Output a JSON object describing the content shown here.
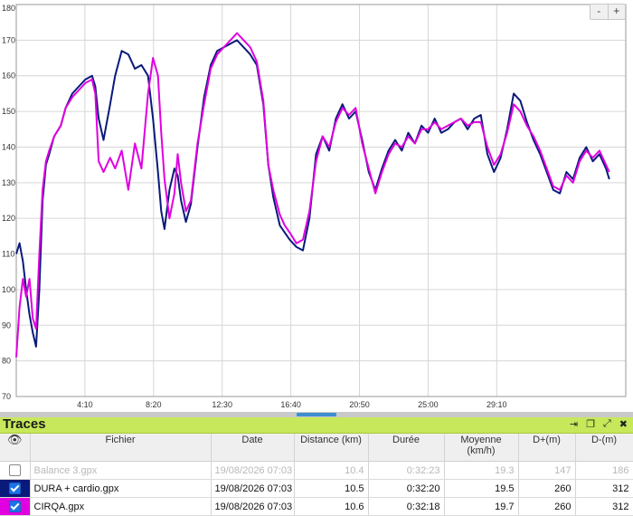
{
  "chart_data": {
    "type": "line",
    "title": "",
    "xlabel": "",
    "ylabel": "",
    "ylim": [
      70,
      180
    ],
    "yticks": [
      70,
      80,
      90,
      100,
      110,
      120,
      130,
      140,
      150,
      160,
      170,
      180
    ],
    "xlim_minutes": [
      0,
      37
    ],
    "xticks": [
      {
        "label": "4:10",
        "value": 4.167
      },
      {
        "label": "8:20",
        "value": 8.333
      },
      {
        "label": "12:30",
        "value": 12.5
      },
      {
        "label": "16:40",
        "value": 16.667
      },
      {
        "label": "20:50",
        "value": 20.833
      },
      {
        "label": "25:00",
        "value": 25.0
      },
      {
        "label": "29:10",
        "value": 29.167
      }
    ],
    "grid": true,
    "series": [
      {
        "name": "DURA + cardio.gpx",
        "color": "#0a1a7a",
        "x": [
          0,
          0.2,
          0.4,
          0.6,
          0.8,
          1.0,
          1.2,
          1.4,
          1.6,
          1.8,
          2.0,
          2.3,
          2.7,
          3.0,
          3.4,
          3.8,
          4.2,
          4.6,
          4.8,
          5.0,
          5.3,
          5.7,
          6.0,
          6.4,
          6.8,
          7.2,
          7.6,
          8.0,
          8.3,
          8.6,
          8.8,
          9.0,
          9.3,
          9.6,
          9.8,
          10.0,
          10.3,
          10.6,
          11.0,
          11.4,
          11.8,
          12.2,
          12.6,
          13.0,
          13.4,
          13.8,
          14.2,
          14.6,
          15.0,
          15.3,
          15.6,
          16.0,
          16.3,
          16.6,
          17.0,
          17.4,
          17.8,
          18.2,
          18.6,
          19.0,
          19.4,
          19.8,
          20.2,
          20.6,
          21.0,
          21.4,
          21.8,
          22.2,
          22.6,
          23.0,
          23.4,
          23.8,
          24.2,
          24.6,
          25.0,
          25.4,
          25.8,
          26.2,
          26.6,
          27.0,
          27.4,
          27.8,
          28.2,
          28.6,
          29.0,
          29.4,
          29.8,
          30.2,
          30.6,
          31.0,
          31.4,
          31.8,
          32.2,
          32.6,
          33.0,
          33.4,
          33.8,
          34.2,
          34.6,
          35.0,
          35.4,
          35.8,
          36.0
        ],
        "values": [
          110,
          113,
          108,
          100,
          93,
          88,
          84,
          100,
          125,
          135,
          138,
          143,
          146,
          151,
          155,
          157,
          159,
          160,
          157,
          148,
          142,
          152,
          160,
          167,
          166,
          162,
          163,
          160,
          148,
          133,
          122,
          117,
          128,
          134,
          132,
          125,
          119,
          124,
          140,
          154,
          163,
          167,
          168,
          169,
          170,
          168,
          166,
          163,
          152,
          135,
          126,
          118,
          116,
          114,
          112,
          111,
          120,
          138,
          143,
          139,
          148,
          152,
          148,
          150,
          142,
          133,
          128,
          134,
          139,
          142,
          139,
          144,
          141,
          146,
          144,
          148,
          144,
          145,
          147,
          148,
          145,
          148,
          149,
          138,
          133,
          137,
          145,
          155,
          153,
          147,
          142,
          138,
          133,
          128,
          127,
          133,
          131,
          137,
          140,
          136,
          138,
          134,
          131
        ]
      },
      {
        "name": "CIRQA.gpx",
        "color": "#e000e0",
        "x": [
          0,
          0.2,
          0.4,
          0.6,
          0.8,
          1.0,
          1.2,
          1.4,
          1.6,
          1.8,
          2.0,
          2.3,
          2.7,
          3.0,
          3.4,
          3.8,
          4.2,
          4.6,
          4.8,
          5.0,
          5.3,
          5.7,
          6.0,
          6.4,
          6.8,
          7.2,
          7.6,
          8.0,
          8.3,
          8.6,
          8.8,
          9.0,
          9.3,
          9.6,
          9.8,
          10.0,
          10.3,
          10.6,
          11.0,
          11.4,
          11.8,
          12.2,
          12.6,
          13.0,
          13.4,
          13.8,
          14.2,
          14.6,
          15.0,
          15.3,
          15.6,
          16.0,
          16.3,
          16.6,
          17.0,
          17.4,
          17.8,
          18.2,
          18.6,
          19.0,
          19.4,
          19.8,
          20.2,
          20.6,
          21.0,
          21.4,
          21.8,
          22.2,
          22.6,
          23.0,
          23.4,
          23.8,
          24.2,
          24.6,
          25.0,
          25.4,
          25.8,
          26.2,
          26.6,
          27.0,
          27.4,
          27.8,
          28.2,
          28.6,
          29.0,
          29.4,
          29.8,
          30.2,
          30.6,
          31.0,
          31.4,
          31.8,
          32.2,
          32.6,
          33.0,
          33.4,
          33.8,
          34.2,
          34.6,
          35.0,
          35.4,
          35.8,
          36.0
        ],
        "values": [
          81,
          95,
          103,
          98,
          103,
          92,
          89,
          110,
          128,
          136,
          139,
          143,
          146,
          151,
          154,
          156,
          158,
          159,
          155,
          136,
          133,
          137,
          134,
          139,
          128,
          141,
          134,
          155,
          165,
          160,
          144,
          131,
          120,
          127,
          138,
          130,
          122,
          125,
          141,
          152,
          162,
          166,
          168,
          170,
          172,
          170,
          168,
          164,
          153,
          135,
          128,
          121,
          118,
          116,
          113,
          114,
          122,
          136,
          143,
          140,
          147,
          151,
          149,
          151,
          141,
          134,
          127,
          133,
          138,
          141,
          140,
          143,
          141,
          145,
          145,
          147,
          145,
          146,
          147,
          148,
          146,
          147,
          147,
          140,
          135,
          138,
          144,
          152,
          150,
          146,
          143,
          139,
          134,
          129,
          128,
          132,
          130,
          136,
          139,
          137,
          139,
          135,
          133
        ]
      }
    ]
  },
  "toolbar": {
    "zoom_out": "-",
    "zoom_in": "+"
  },
  "traces": {
    "title": "Traces",
    "columns": [
      "Fichier",
      "Date",
      "Distance (km)",
      "Durée",
      "Moyenne (km/h)",
      "D+(m)",
      "D-(m)"
    ],
    "rows": [
      {
        "enabled": false,
        "checked": false,
        "color": "",
        "file": "Balance 3.gpx",
        "date": "19/08/2026 07:03",
        "distance": "10.4",
        "duration": "0:32:23",
        "average": "19.3",
        "dplus": "147",
        "dminus": "186"
      },
      {
        "enabled": true,
        "checked": true,
        "color": "#0a1a7a",
        "file": "DURA + cardio.gpx",
        "date": "19/08/2026 07:03",
        "distance": "10.5",
        "duration": "0:32:20",
        "average": "19.5",
        "dplus": "260",
        "dminus": "312"
      },
      {
        "enabled": true,
        "checked": true,
        "color": "#e000e0",
        "file": "CIRQA.gpx",
        "date": "19/08/2026 07:03",
        "distance": "10.6",
        "duration": "0:32:18",
        "average": "19.7",
        "dplus": "260",
        "dminus": "312"
      }
    ]
  }
}
